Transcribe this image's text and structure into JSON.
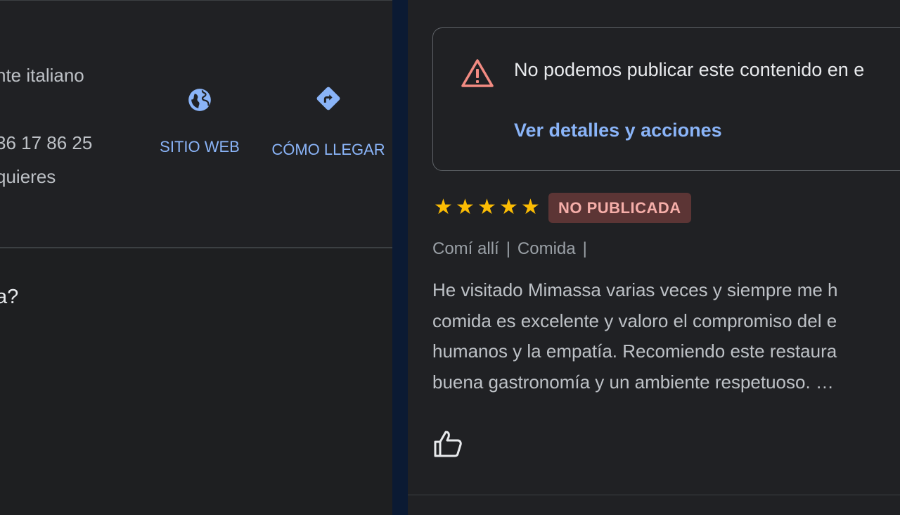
{
  "left_panel": {
    "category_text": "nte italiano",
    "phone_text": "36 17 86 25",
    "quiere_text": "quieres",
    "question_text": "a?",
    "actions": [
      {
        "label": "SITIO WEB",
        "icon": "globe-icon"
      },
      {
        "label": "CÓMO LLEGAR",
        "icon": "directions-icon"
      }
    ]
  },
  "review": {
    "warning": {
      "icon": "warning-triangle-icon",
      "text": "No podemos publicar este contenido en e",
      "link": "Ver detalles y acciones"
    },
    "rating": 5,
    "badge": "NO PUBLICADA",
    "meta": [
      "Comí allí",
      "Comida"
    ],
    "meta_separator": "|",
    "text_lines": [
      "He visitado Mimassa varias veces y siempre me h",
      "comida es excelente y valoro el compromiso del e",
      "humanos y la empatía. Recomiendo este restaura",
      "buena gastronomía y un ambiente respetuoso. …"
    ],
    "like_icon": "thumbs-up-icon"
  },
  "colors": {
    "background": "#202124",
    "accent_blue": "#8ab4f8",
    "star": "#fbbc04",
    "warning": "#f28b82",
    "badge_bg": "#5c3535",
    "badge_text": "#f6aea9"
  }
}
